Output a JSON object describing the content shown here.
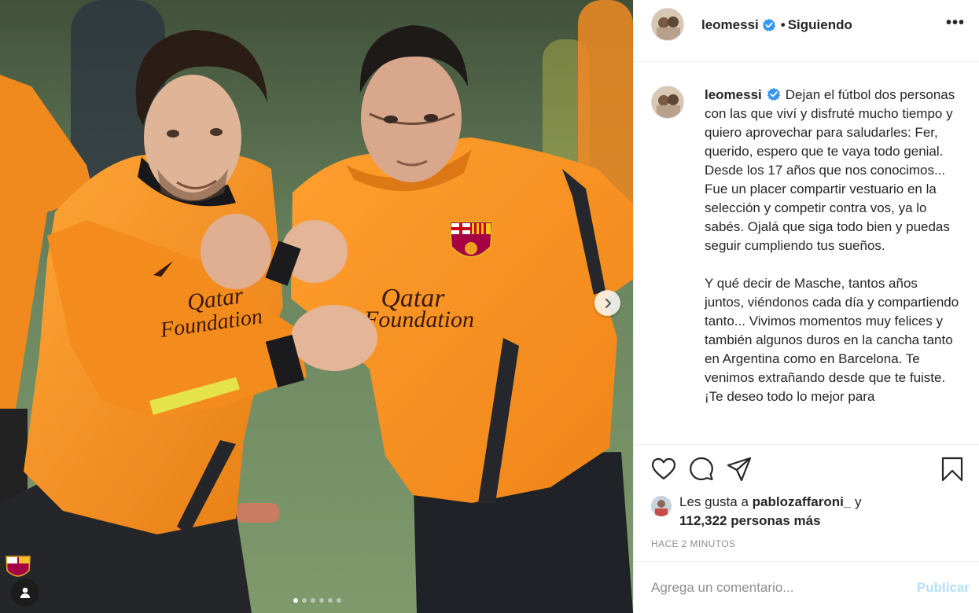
{
  "post": {
    "username": "leomessi",
    "follow_separator": "•",
    "follow_status": "Siguiendo",
    "more_label": "•••",
    "caption": "Dejan el fútbol dos personas con las que viví y disfruté mucho tiempo y quiero aprovechar para saludarles: Fer, querido, espero que te vaya todo genial. Desde los 17 años que nos conocimos... Fue un placer compartir vestuario en la selección y competir contra vos, ya lo sabés. Ojalá que siga todo bien y puedas seguir cumpliendo tus sueños.\n\nY qué decir de Masche, tantos años juntos, viéndonos cada día y compartiendo tanto... Vivimos momentos muy felices y también algunos duros en la cancha tanto en Argentina como en Barcelona. Te venimos extrañando desde que te fuiste. ¡Te deseo todo lo mejor para",
    "likes_prefix": "Les gusta a",
    "liked_by": "pablozaffaroni_",
    "likes_connector": "y",
    "likes_count": "112,322 personas más",
    "timestamp": "HACE 2 MINUTOS",
    "comment_placeholder": "Agrega un comentario...",
    "publish_label": "Publicar"
  },
  "carousel": {
    "slides_total": 6,
    "active_index": 0
  },
  "photo_text": {
    "sponsor_right_1": "Qatar",
    "sponsor_right_2": "Foundation",
    "sponsor_left_1": "Qatar",
    "sponsor_left_2": "Foundation"
  },
  "icons": {
    "verified": "verified-badge-icon",
    "heart": "heart-icon",
    "comment": "comment-icon",
    "share": "share-icon",
    "save": "bookmark-icon",
    "next": "chevron-right-icon",
    "tagged": "person-icon"
  },
  "colors": {
    "verified_blue": "#3897f0",
    "publish_disabled": "#b2dffc",
    "jersey_orange": "#f7931e",
    "border": "#efefef"
  }
}
